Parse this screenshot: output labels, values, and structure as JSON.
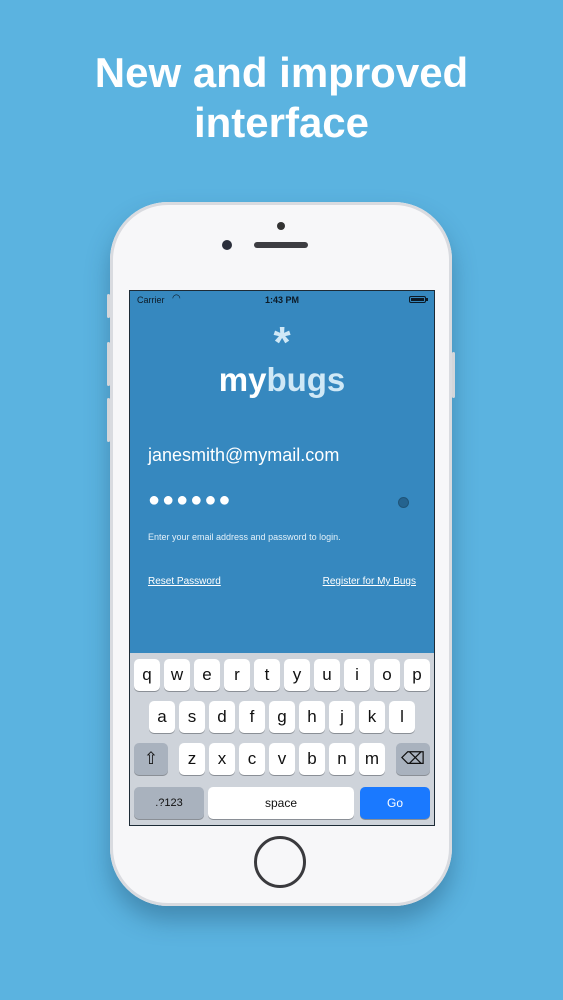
{
  "headline": {
    "line1": "New and improved",
    "line2": "interface"
  },
  "status_bar": {
    "carrier": "Carrier",
    "time": "1:43 PM"
  },
  "logo": {
    "star": "*",
    "my": "my",
    "bugs": "bugs"
  },
  "login": {
    "email_value": "janesmith@mymail.com",
    "password_mask": "●●●●●●",
    "hint": "Enter your email address and password to login.",
    "reset_link": "Reset Password",
    "register_link": "Register for My Bugs"
  },
  "keyboard": {
    "row1": [
      "q",
      "w",
      "e",
      "r",
      "t",
      "y",
      "u",
      "i",
      "o",
      "p"
    ],
    "row2": [
      "a",
      "s",
      "d",
      "f",
      "g",
      "h",
      "j",
      "k",
      "l"
    ],
    "row3": [
      "z",
      "x",
      "c",
      "v",
      "b",
      "n",
      "m"
    ],
    "shift": "⇧",
    "delete": "⌫",
    "numbers": ".?123",
    "space": "space",
    "go": "Go"
  },
  "colors": {
    "background": "#5bb3e0",
    "screen": "#3688bf",
    "go_key": "#1a79ff"
  }
}
